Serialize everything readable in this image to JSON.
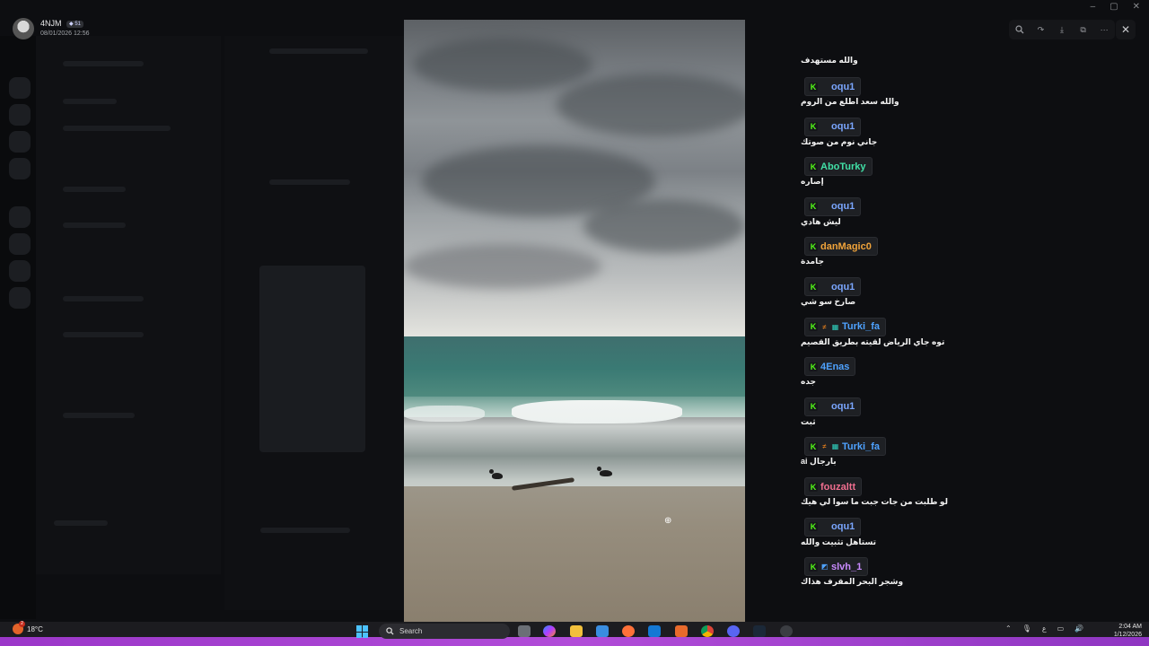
{
  "viewer": {
    "user": {
      "name": "4NJM",
      "badge": "51",
      "timestamp": "08/01/2026 12:56"
    },
    "toolbar": {
      "buttons": [
        "zoom-in-icon",
        "share-icon",
        "download-icon",
        "open-external-icon",
        "more-icon"
      ],
      "close_label": "✕"
    }
  },
  "chat": {
    "first_line": "والله مستهدف",
    "messages": [
      {
        "user": "oqu1",
        "color": "#7aa6ff",
        "text": "والله سعد اطلع من الروم",
        "badges": [
          "kick",
          "blank"
        ]
      },
      {
        "user": "oqu1",
        "color": "#7aa6ff",
        "text": "جاني نوم من صوتك",
        "badges": [
          "kick",
          "blank"
        ]
      },
      {
        "user": "AboTurky",
        "color": "#41e0a6",
        "text": "إصاره",
        "badges": [
          "kick"
        ]
      },
      {
        "user": "oqu1",
        "color": "#7aa6ff",
        "text": "ليش هادي",
        "badges": [
          "kick",
          "blank"
        ]
      },
      {
        "user": "danMagic0",
        "color": "#f0a33a",
        "text": "جامدة",
        "badges": [
          "kick"
        ]
      },
      {
        "user": "oqu1",
        "color": "#7aa6ff",
        "text": "صارخ سو شي",
        "badges": [
          "kick",
          "blank"
        ]
      },
      {
        "user": "Turki_fa",
        "color": "#4ea2ff",
        "text": "توه جاي الرياض لقيته بطريق القصيم",
        "badges": [
          "kick",
          "flame",
          "gift"
        ]
      },
      {
        "user": "4Enas",
        "color": "#4ea2ff",
        "text": "جده",
        "badges": [
          "kick"
        ]
      },
      {
        "user": "oqu1",
        "color": "#7aa6ff",
        "text": "ثبت",
        "badges": [
          "kick",
          "blank"
        ]
      },
      {
        "user": "Turki_fa",
        "color": "#4ea2ff",
        "text": "ai بارجال",
        "badges": [
          "kick",
          "flame",
          "gift"
        ]
      },
      {
        "user": "fouzaltt",
        "color": "#f06e8f",
        "text": "لو طلبت من جات جبت ما سوا لي هيك",
        "badges": [
          "kick"
        ]
      },
      {
        "user": "oqu1",
        "color": "#7aa6ff",
        "text": "تستاهل تثبيت والله",
        "badges": [
          "kick",
          "blank"
        ]
      },
      {
        "user": "slvh_1",
        "color": "#c98bff",
        "text": "وشجر البحر المقرف هذاك",
        "badges": [
          "kick",
          "star"
        ]
      }
    ]
  },
  "taskbar": {
    "weather": "18°C",
    "notification_count": "2",
    "search_placeholder": "Search",
    "time": "2:04 AM",
    "date": "1/12/2026"
  }
}
